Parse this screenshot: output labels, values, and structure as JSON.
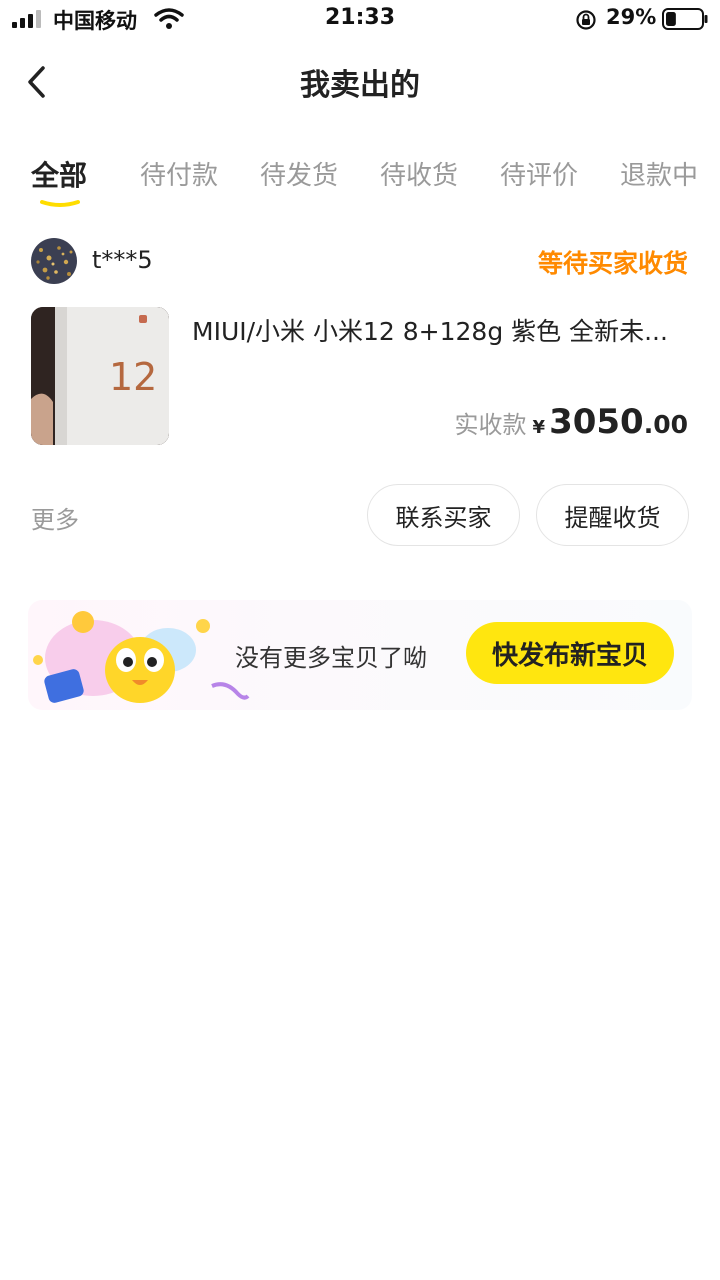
{
  "status_bar": {
    "carrier": "中国移动",
    "time": "21:33",
    "battery": "29%",
    "battery_level": 0.29
  },
  "nav": {
    "title": "我卖出的"
  },
  "tabs": [
    {
      "label": "全部",
      "active": true
    },
    {
      "label": "待付款",
      "active": false
    },
    {
      "label": "待发货",
      "active": false
    },
    {
      "label": "待收货",
      "active": false
    },
    {
      "label": "待评价",
      "active": false
    },
    {
      "label": "退款中",
      "active": false
    }
  ],
  "order": {
    "buyer_name": "t***5",
    "status": "等待买家收货",
    "product_title": "MIUI/小米 小米12 8+128g 紫色 全新未...",
    "thumb_label": "12",
    "price_label": "实收款",
    "currency": "¥",
    "price_int": "3050",
    "price_dec": ".00",
    "more": "更多",
    "contact_button": "联系买家",
    "remind_button": "提醒收货"
  },
  "banner": {
    "text": "没有更多宝贝了呦",
    "button": "快发布新宝贝"
  },
  "colors": {
    "accent_yellow": "#ffe60f",
    "status_orange": "#ff8a00",
    "muted_gray": "#9a9a9a"
  }
}
